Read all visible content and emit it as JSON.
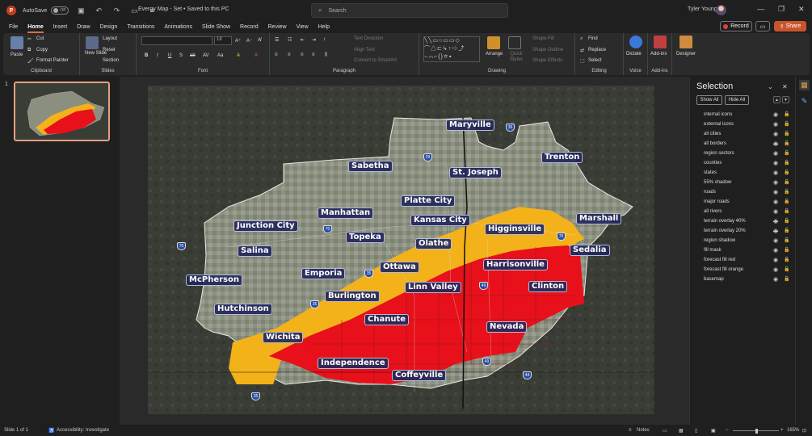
{
  "titlebar": {
    "autosave_label": "AutoSave",
    "autosave_state": "Off",
    "doc_title": "Evergy Map - Set • Saved to this PC",
    "search_placeholder": "Search",
    "user_name": "Tyler Young"
  },
  "menu": {
    "tabs": [
      "File",
      "Home",
      "Insert",
      "Draw",
      "Design",
      "Transitions",
      "Animations",
      "Slide Show",
      "Record",
      "Review",
      "View",
      "Help"
    ],
    "active": "Home",
    "record_label": "Record",
    "share_label": "Share"
  },
  "ribbon": {
    "clipboard": {
      "label": "Clipboard",
      "paste": "Paste",
      "cut": "Cut",
      "copy": "Copy",
      "format_painter": "Format Painter"
    },
    "slides": {
      "label": "Slides",
      "new_slide": "New Slide",
      "layout": "Layout",
      "reset": "Reset",
      "section": "Section"
    },
    "font": {
      "label": "Font",
      "font_name": "",
      "font_size": "18",
      "buttons": [
        "B",
        "I",
        "U",
        "S",
        "ab",
        "AV",
        "Aa",
        "A",
        "A"
      ]
    },
    "paragraph": {
      "label": "Paragraph",
      "text_direction": "Text Direction",
      "align_text": "Align Text",
      "convert_smartart": "Convert to SmartArt"
    },
    "drawing": {
      "label": "Drawing",
      "arrange": "Arrange",
      "quick_styles": "Quick Styles",
      "shape_fill": "Shape Fill",
      "shape_outline": "Shape Outline",
      "shape_effects": "Shape Effects"
    },
    "editing": {
      "label": "Editing",
      "find": "Find",
      "replace": "Replace",
      "select": "Select"
    },
    "voice": {
      "label": "Voice",
      "dictate": "Dictate"
    },
    "addins": {
      "label": "Add-ins",
      "addins": "Add-ins"
    },
    "designer": {
      "designer": "Designer"
    }
  },
  "thumbnails": {
    "slide_number": "1"
  },
  "map": {
    "cities": [
      {
        "name": "Maryville"
      },
      {
        "name": "Trenton"
      },
      {
        "name": "Sabetha"
      },
      {
        "name": "St. Joseph"
      },
      {
        "name": "Platte City"
      },
      {
        "name": "Kansas City"
      },
      {
        "name": "Marshall"
      },
      {
        "name": "Junction City"
      },
      {
        "name": "Manhattan"
      },
      {
        "name": "Higginsville"
      },
      {
        "name": "Topeka"
      },
      {
        "name": "Olathe"
      },
      {
        "name": "Sedalia"
      },
      {
        "name": "Salina"
      },
      {
        "name": "Ottawa"
      },
      {
        "name": "Harrisonville"
      },
      {
        "name": "Emporia"
      },
      {
        "name": "McPherson"
      },
      {
        "name": "Linn Valley"
      },
      {
        "name": "Clinton"
      },
      {
        "name": "Burlington"
      },
      {
        "name": "Hutchinson"
      },
      {
        "name": "Chanute"
      },
      {
        "name": "Nevada"
      },
      {
        "name": "Wichita"
      },
      {
        "name": "Independence"
      },
      {
        "name": "Coffeyville"
      }
    ],
    "highways": [
      "35",
      "29",
      "70",
      "70",
      "70",
      "35",
      "49",
      "49",
      "44",
      "35",
      "35"
    ],
    "colors": {
      "red": "#e8101a",
      "orange": "#f3b21a",
      "terrain": "#3a3d36",
      "label_bg": "#23285a"
    }
  },
  "selection_pane": {
    "title": "Selection",
    "show_all": "Show All",
    "hide_all": "Hide All",
    "layers": [
      {
        "name": "internal icons",
        "visible": true
      },
      {
        "name": "external icons",
        "visible": true
      },
      {
        "name": "all cities",
        "visible": true
      },
      {
        "name": "all borders",
        "visible": false
      },
      {
        "name": "region sectors",
        "visible": true
      },
      {
        "name": "counties",
        "visible": true
      },
      {
        "name": "states",
        "visible": true
      },
      {
        "name": "55% shadow",
        "visible": true
      },
      {
        "name": "roads",
        "visible": true
      },
      {
        "name": "major roads",
        "visible": true
      },
      {
        "name": "all rivers",
        "visible": true
      },
      {
        "name": "terrain overlay 40%",
        "visible": false
      },
      {
        "name": "terrain overlay 20%",
        "visible": false
      },
      {
        "name": "region shadow",
        "visible": true
      },
      {
        "name": "fill mask",
        "visible": true
      },
      {
        "name": "forecast fill red",
        "visible": true
      },
      {
        "name": "forecast fill orange",
        "visible": true
      },
      {
        "name": "basemap",
        "visible": true
      }
    ]
  },
  "statusbar": {
    "slide_of": "Slide 1 of 1",
    "accessibility": "Accessibility: Investigate",
    "notes": "Notes",
    "zoom": "165%"
  }
}
